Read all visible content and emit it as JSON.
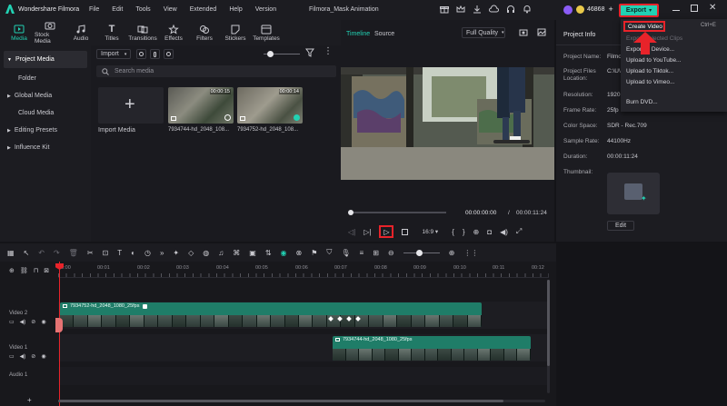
{
  "app": {
    "name": "Wondershare Filmora",
    "project_title": "Filmora_Mask Animation",
    "menu": [
      "File",
      "Edit",
      "Tools",
      "View",
      "Extended",
      "Help",
      "Version"
    ],
    "credits": "46868",
    "export_label": "Export"
  },
  "toolbar": {
    "tools": [
      {
        "label": "Media",
        "icon": "media-icon"
      },
      {
        "label": "Stock Media",
        "icon": "stock-media-icon"
      },
      {
        "label": "Audio",
        "icon": "audio-icon"
      },
      {
        "label": "Titles",
        "icon": "titles-icon"
      },
      {
        "label": "Transitions",
        "icon": "transitions-icon"
      },
      {
        "label": "Effects",
        "icon": "effects-icon"
      },
      {
        "label": "Filters",
        "icon": "filters-icon"
      },
      {
        "label": "Stickers",
        "icon": "stickers-icon"
      },
      {
        "label": "Templates",
        "icon": "templates-icon"
      }
    ]
  },
  "leftnav": {
    "items": [
      "Project Media",
      "Folder",
      "Global Media",
      "Cloud Media",
      "Editing Presets",
      "Influence Kit"
    ]
  },
  "media": {
    "import_dropdown": "Import",
    "search_placeholder": "Search media",
    "import_tile_label": "Import Media",
    "clips": [
      {
        "name": "7934744-hd_2048_108...",
        "duration": "00:00:15"
      },
      {
        "name": "7934752-hd_2048_108...",
        "duration": "00:00:14"
      }
    ]
  },
  "player": {
    "tab_timeline": "Timeline",
    "tab_source": "Source",
    "quality": "Full Quality",
    "current_time": "00:00:00:00",
    "separator": "/",
    "total_time": "00:00:11:24",
    "ratio": "16:9"
  },
  "info": {
    "header": "Project Info",
    "rows": [
      {
        "label": "Project Name:",
        "value": "Filmo"
      },
      {
        "label": "Project Files\nLocation:",
        "value": "C:\\U\\nFilmo\\nAnim"
      },
      {
        "label": "Resolution:",
        "value": "1920"
      },
      {
        "label": "Frame Rate:",
        "value": "25fp"
      },
      {
        "label": "Color Space:",
        "value": "SDR - Rec.709"
      },
      {
        "label": "Sample Rate:",
        "value": "44100Hz"
      },
      {
        "label": "Duration:",
        "value": "00:00:11:24"
      }
    ],
    "thumbnail_label": "Thumbnail:",
    "edit_label": "Edit"
  },
  "export_menu": {
    "items": [
      "Create Video",
      "Export Selected Clips",
      "Export to Device...",
      "Upload to YouTube...",
      "Upload to Tiktok...",
      "Upload to Vimeo...",
      "Burn DVD..."
    ],
    "shortcut": "Ctrl+E"
  },
  "timeline": {
    "ruler": [
      "00:00",
      "00:01",
      "00:02",
      "00:03",
      "00:04",
      "00:05",
      "00:06",
      "00:07",
      "00:08",
      "00:09",
      "00:10",
      "00:11",
      "00:12"
    ],
    "tracks": [
      "Video 2",
      "Video 1",
      "Audio 1"
    ],
    "clip_v2": "7934752-hd_2048_1080_25fps",
    "clip_v1": "7934744-hd_2048_1080_25fps"
  },
  "colors": {
    "accent": "#22d1b3",
    "highlight": "#e8232a"
  }
}
